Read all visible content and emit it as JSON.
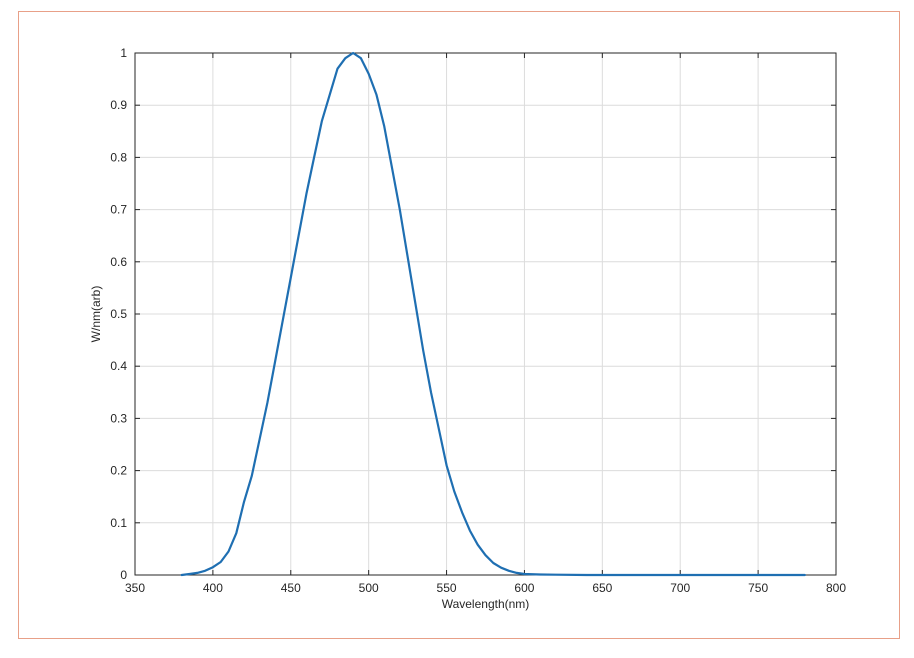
{
  "chart_data": {
    "type": "line",
    "title": "",
    "xlabel": "Wavelength(nm)",
    "ylabel": "W/nm(arb)",
    "xlim": [
      350,
      800
    ],
    "ylim": [
      0,
      1
    ],
    "xticks": [
      350,
      400,
      450,
      500,
      550,
      600,
      650,
      700,
      750,
      800
    ],
    "yticks": [
      0,
      0.1,
      0.2,
      0.3,
      0.4,
      0.5,
      0.6,
      0.7,
      0.8,
      0.9,
      1
    ],
    "xtick_labels": [
      "350",
      "400",
      "450",
      "500",
      "550",
      "600",
      "650",
      "700",
      "750",
      "800"
    ],
    "ytick_labels": [
      "0",
      "0.1",
      "0.2",
      "0.3",
      "0.4",
      "0.5",
      "0.6",
      "0.7",
      "0.8",
      "0.9",
      "1"
    ],
    "grid": true,
    "line_color": "#1f6fb2",
    "series": [
      {
        "x": [
          380,
          385,
          390,
          395,
          400,
          405,
          410,
          415,
          420,
          425,
          430,
          435,
          440,
          445,
          450,
          455,
          460,
          465,
          470,
          475,
          480,
          485,
          490,
          495,
          500,
          505,
          510,
          515,
          520,
          525,
          530,
          535,
          540,
          545,
          550,
          555,
          560,
          565,
          570,
          575,
          580,
          585,
          590,
          595,
          600,
          610,
          620,
          640,
          660,
          700,
          740,
          780
        ],
        "y": [
          0.0,
          0.002,
          0.004,
          0.008,
          0.015,
          0.025,
          0.045,
          0.08,
          0.14,
          0.19,
          0.26,
          0.33,
          0.41,
          0.49,
          0.57,
          0.65,
          0.73,
          0.8,
          0.87,
          0.92,
          0.97,
          0.99,
          1.0,
          0.99,
          0.96,
          0.92,
          0.86,
          0.78,
          0.7,
          0.61,
          0.52,
          0.43,
          0.35,
          0.28,
          0.21,
          0.16,
          0.12,
          0.085,
          0.058,
          0.038,
          0.023,
          0.014,
          0.008,
          0.004,
          0.002,
          0.001,
          0.0005,
          0.0,
          0.0,
          0.0,
          0.0,
          0.0
        ]
      }
    ]
  }
}
